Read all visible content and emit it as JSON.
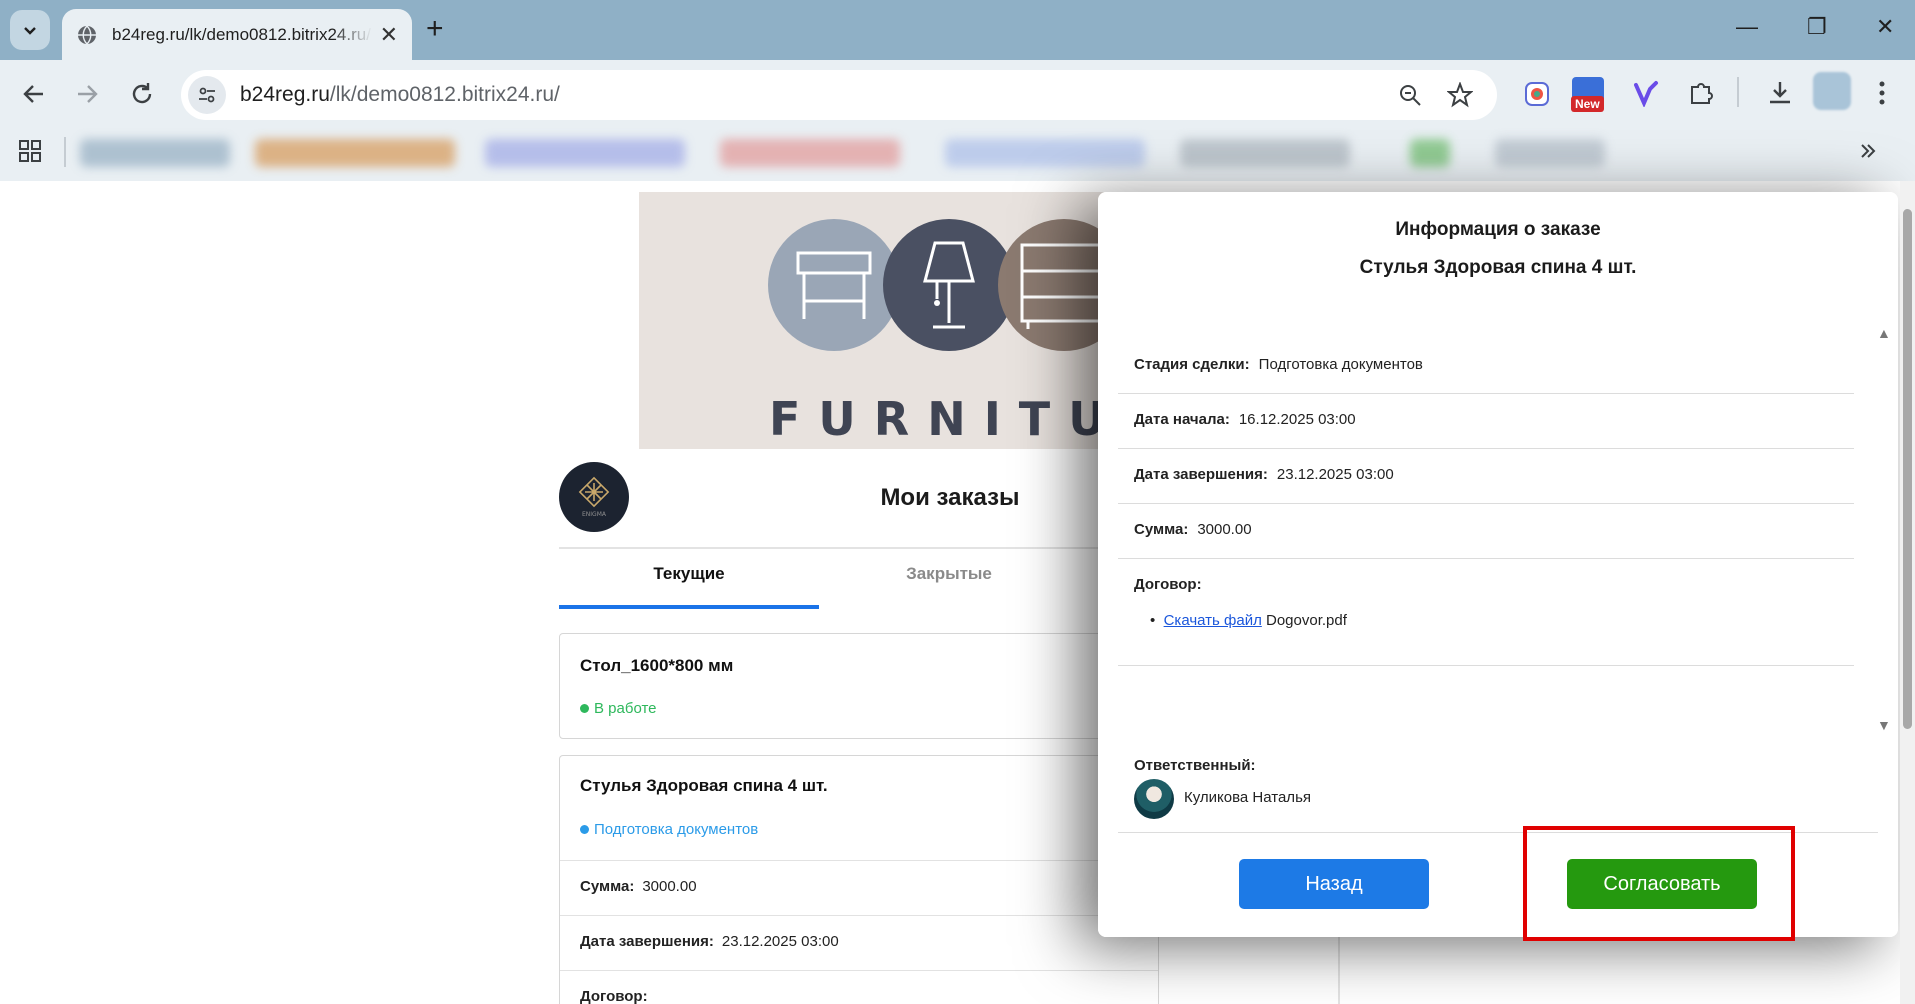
{
  "browser": {
    "tab_title": "b24reg.ru/lk/demo0812.bitrix24.ru/",
    "tab_close": "✕",
    "new_tab": "+",
    "url_host": "b24reg.ru",
    "url_path": "/lk/demo0812.bitrix24.ru/",
    "badge_new": "New",
    "window": {
      "minimize": "—",
      "restore": "❐",
      "close": "✕"
    },
    "icons": [
      "chevron-down-icon",
      "globe-icon",
      "back-icon",
      "forward-icon",
      "reload-icon",
      "site-info-icon",
      "zoom-icon",
      "star-icon",
      "lens-extension-icon",
      "new-extension-icon",
      "copilot-extension-icon",
      "extensions-puzzle-icon",
      "download-icon",
      "profile-icon",
      "menu-dots-icon",
      "apps-grid-icon",
      "more-bookmarks-icon"
    ]
  },
  "page": {
    "banner_text": "FURNITURE",
    "logo_text": "ENIGMA",
    "heading": "Мои заказы",
    "tabs": {
      "current": "Текущие",
      "closed": "Закрытые"
    },
    "orders": [
      {
        "title": "Стол_1600*800 мм",
        "status": "В работе",
        "status_color": "#2eb85c"
      },
      {
        "title": "Стулья Здоровая спина 4 шт.",
        "status": "Подготовка документов",
        "status_color": "#2b9be8",
        "fields": [
          {
            "label": "Сумма:",
            "value": "3000.00"
          },
          {
            "label": "Дата завершения:",
            "value": "23.12.2025 03:00"
          },
          {
            "label": "Договор:",
            "value": ""
          }
        ]
      }
    ]
  },
  "modal": {
    "title": "Информация о заказе",
    "subtitle": "Стулья Здоровая спина 4 шт.",
    "rows": [
      {
        "label": "Стадия сделки:",
        "value": "Подготовка документов"
      },
      {
        "label": "Дата начала:",
        "value": "16.12.2025 03:00"
      },
      {
        "label": "Дата завершения:",
        "value": "23.12.2025 03:00"
      },
      {
        "label": "Сумма:",
        "value": "3000.00"
      }
    ],
    "contract_label": "Договор:",
    "download_link": "Скачать файл",
    "file_name": "Dogovor.pdf",
    "responsible_label": "Ответственный:",
    "responsible_name": "Куликова Наталья",
    "back_button": "Назад",
    "approve_button": "Согласовать",
    "scroll_up": "▲",
    "scroll_down": "▼"
  },
  "colors": {
    "primary_blue": "#1d7ae6",
    "approve_green": "#25990f",
    "highlight_red": "#e00000",
    "status_in_progress": "#2eb85c",
    "status_docs": "#2b9be8"
  }
}
